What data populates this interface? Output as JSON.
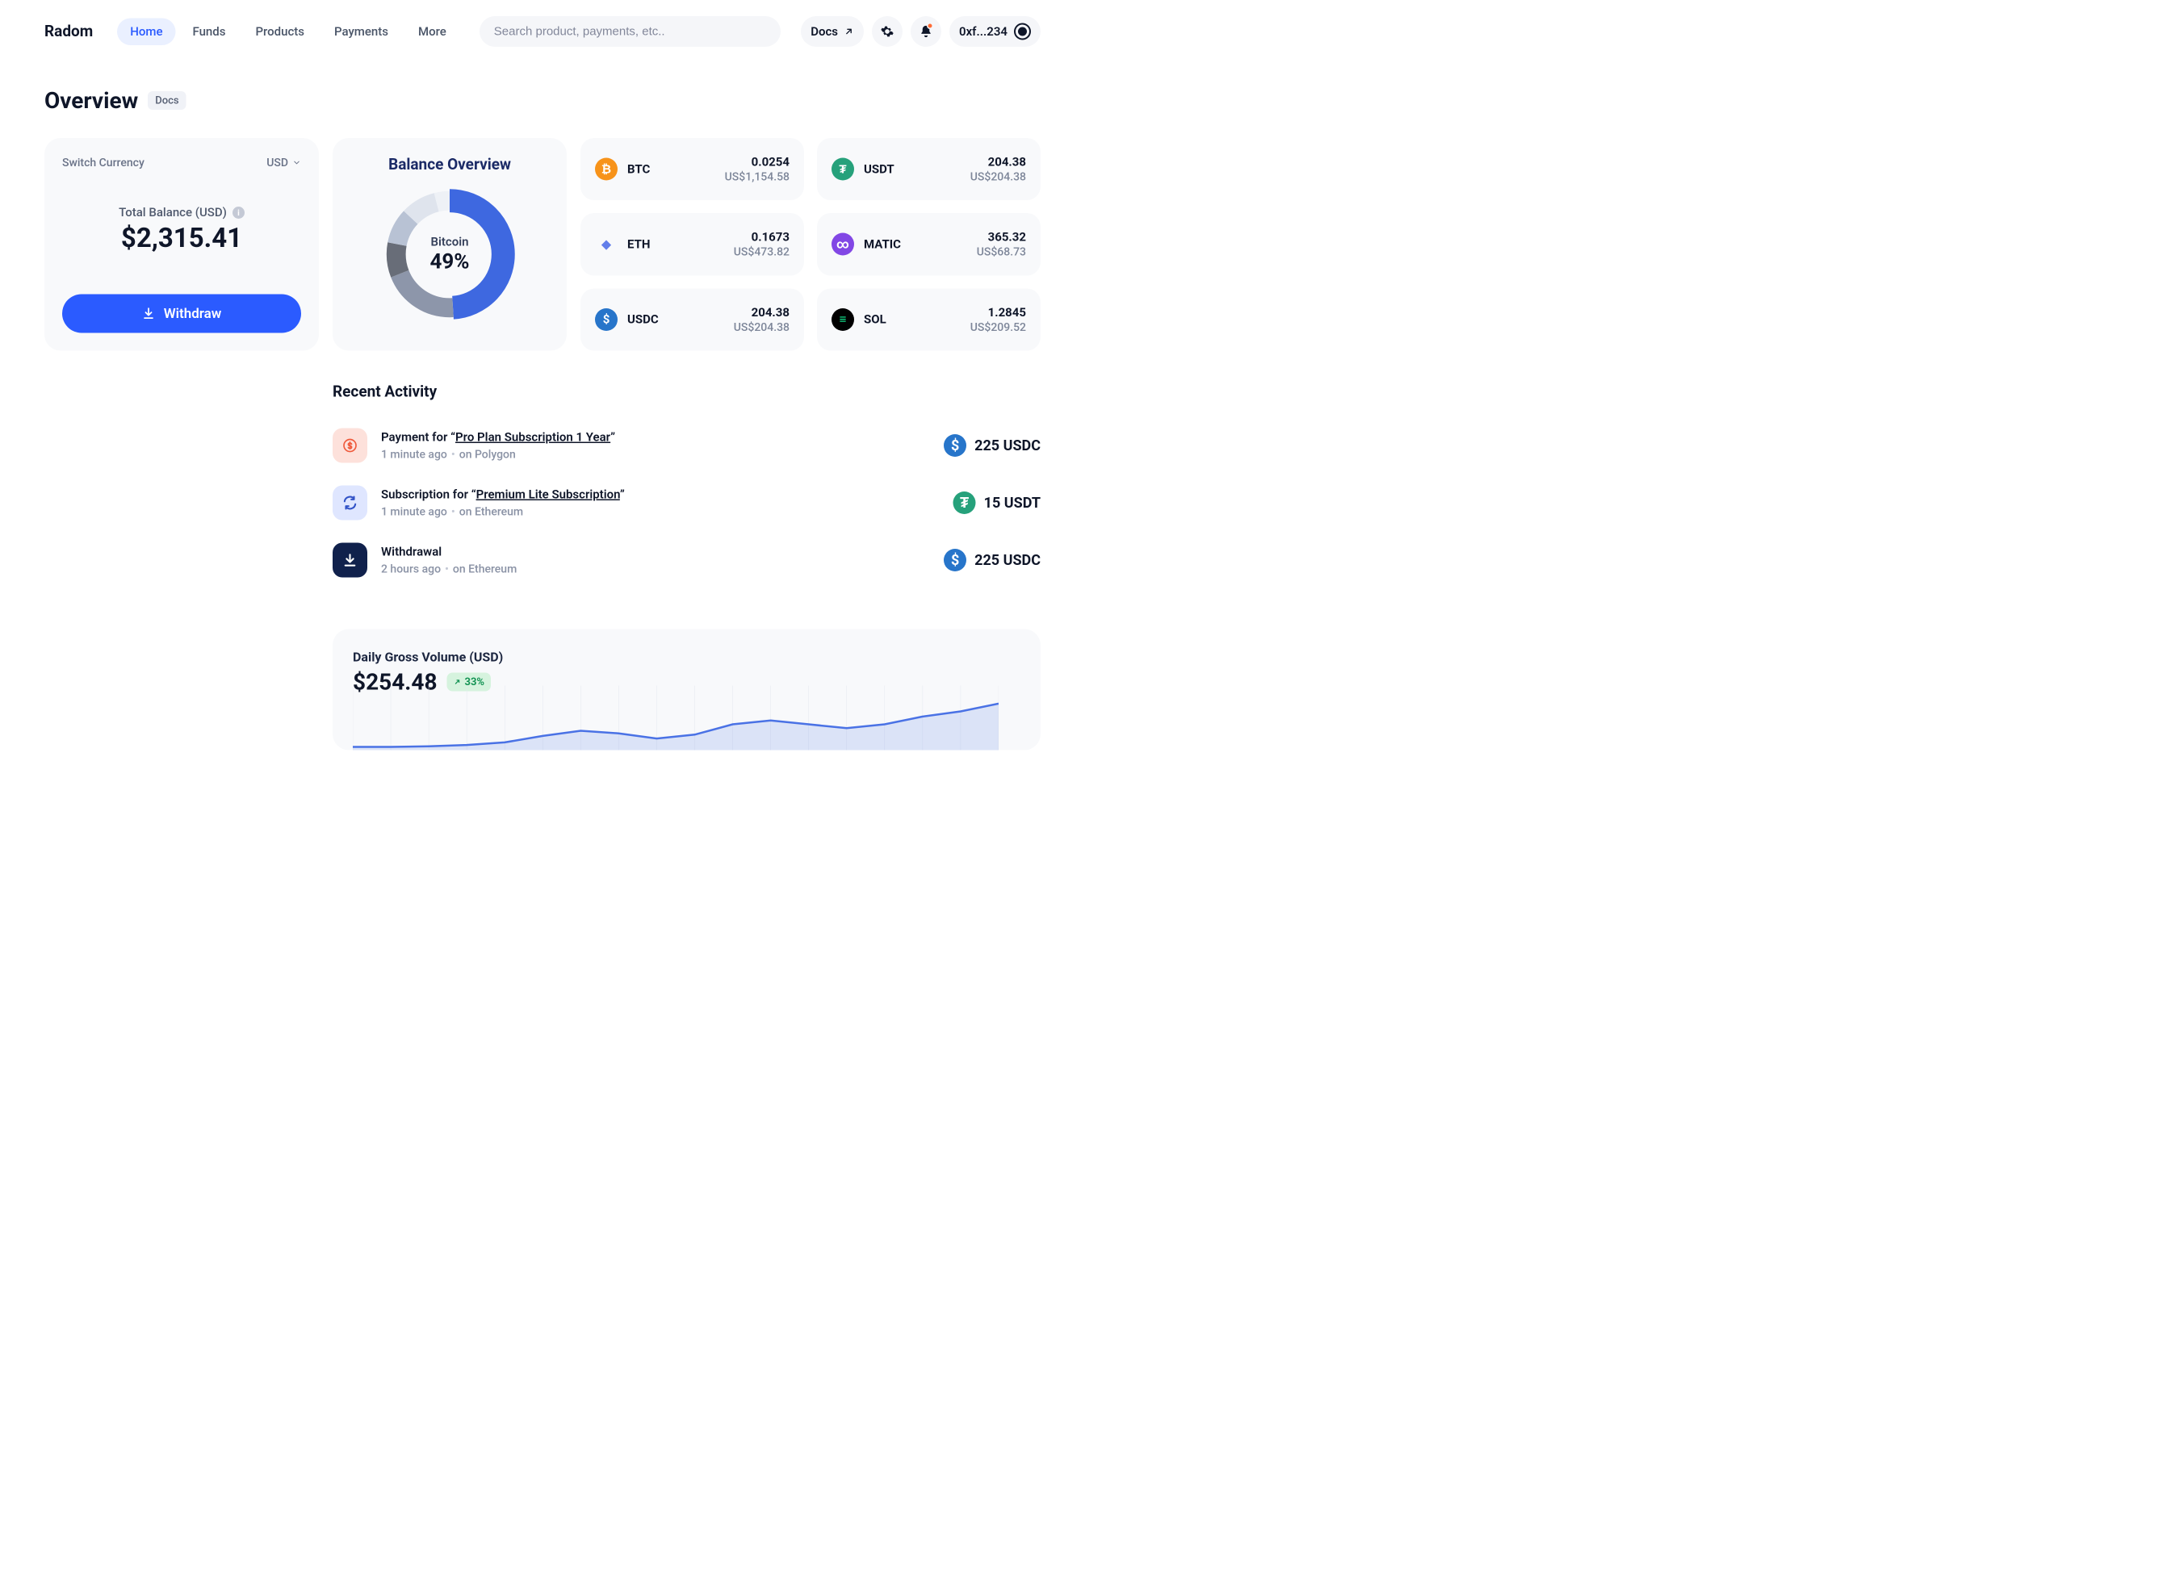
{
  "brand": "Radom",
  "nav": {
    "items": [
      {
        "label": "Home",
        "active": true
      },
      {
        "label": "Funds",
        "active": false
      },
      {
        "label": "Products",
        "active": false
      },
      {
        "label": "Payments",
        "active": false
      },
      {
        "label": "More",
        "active": false
      }
    ]
  },
  "search": {
    "placeholder": "Search product, payments, etc.."
  },
  "header": {
    "docs_label": "Docs",
    "wallet_short": "0xf...234"
  },
  "page": {
    "title": "Overview",
    "docs_chip": "Docs"
  },
  "balance": {
    "switch_label": "Switch Currency",
    "currency": "USD",
    "total_label": "Total Balance (USD)",
    "total_value": "$2,315.41",
    "withdraw_label": "Withdraw"
  },
  "donut": {
    "title": "Balance Overview",
    "center_name": "Bitcoin",
    "center_pct": "49%",
    "slices": [
      {
        "name": "Bitcoin",
        "pct": 49,
        "color": "#3e68e0"
      },
      {
        "name": "Ethereum",
        "pct": 20,
        "color": "#8d96aa"
      },
      {
        "name": "USDT",
        "pct": 9,
        "color": "#686d78"
      },
      {
        "name": "USDC",
        "pct": 9,
        "color": "#b8c2d4"
      },
      {
        "name": "SOL",
        "pct": 9,
        "color": "#dfe4ed"
      },
      {
        "name": "MATIC",
        "pct": 4,
        "color": "#eef1f6"
      }
    ]
  },
  "tokens": [
    {
      "symbol": "BTC",
      "amount": "0.0254",
      "usd": "US$1,154.58",
      "bg": "#f7931a",
      "fg": "#fff",
      "glyph": "₿"
    },
    {
      "symbol": "USDT",
      "amount": "204.38",
      "usd": "US$204.38",
      "bg": "#26a17b",
      "fg": "#fff",
      "glyph": "₮"
    },
    {
      "symbol": "ETH",
      "amount": "0.1673",
      "usd": "US$473.82",
      "bg": "transparent",
      "fg": "#627eea",
      "glyph": "◆"
    },
    {
      "symbol": "MATIC",
      "amount": "365.32",
      "usd": "US$68.73",
      "bg": "#8247e5",
      "fg": "#fff",
      "glyph": "∞"
    },
    {
      "symbol": "USDC",
      "amount": "204.38",
      "usd": "US$204.38",
      "bg": "#2775ca",
      "fg": "#fff",
      "glyph": "$"
    },
    {
      "symbol": "SOL",
      "amount": "1.2845",
      "usd": "US$209.52",
      "bg": "#000",
      "fg": "#14f195",
      "glyph": "≡"
    }
  ],
  "activity": {
    "title": "Recent Activity",
    "rows": [
      {
        "icon_bg": "#fde1db",
        "icon_fg": "#ef5a3c",
        "icon": "dollar",
        "prefix": "Payment for “",
        "link": "Pro Plan Subscription 1 Year",
        "suffix": "”",
        "time": "1 minute ago",
        "network": "on Polygon",
        "amount": "225 USDC",
        "amt_color": "#2775ca",
        "amt_glyph": "$"
      },
      {
        "icon_bg": "#dfe6ff",
        "icon_fg": "#3253c7",
        "icon": "cycle",
        "prefix": "Subscription for  “",
        "link": "Premium Lite Subscription",
        "suffix": "”",
        "time": "1 minute ago",
        "network": "on Ethereum",
        "amount": "15 USDT",
        "amt_color": "#26a17b",
        "amt_glyph": "₮"
      },
      {
        "icon_bg": "#10214c",
        "icon_fg": "#ffffff",
        "icon": "download",
        "prefix": "Withdrawal",
        "link": "",
        "suffix": "",
        "time": "2 hours ago",
        "network": "on Ethereum",
        "amount": "225 USDC",
        "amt_color": "#2775ca",
        "amt_glyph": "$"
      }
    ]
  },
  "volume": {
    "label": "Daily Gross Volume (USD)",
    "value": "$254.48",
    "change": "33%"
  },
  "chart_data": {
    "type": "area",
    "title": "Daily Gross Volume (USD)",
    "ylabel": "USD",
    "xlabel": "",
    "ylim": [
      0,
      100
    ],
    "x": [
      0,
      1,
      2,
      3,
      4,
      5,
      6,
      7,
      8,
      9,
      10,
      11,
      12,
      13,
      14,
      15,
      16,
      17
    ],
    "values": [
      5,
      5,
      6,
      8,
      12,
      22,
      30,
      26,
      18,
      24,
      40,
      46,
      40,
      34,
      40,
      52,
      60,
      72
    ]
  }
}
